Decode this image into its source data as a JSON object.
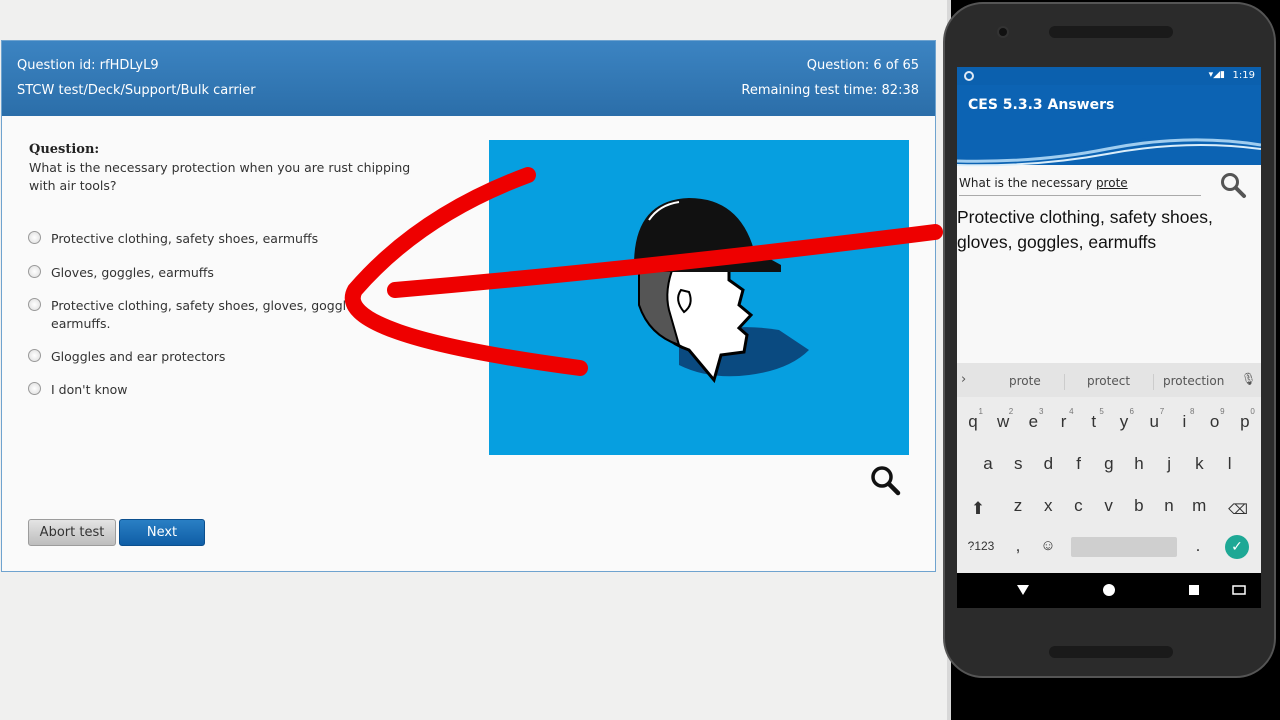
{
  "test": {
    "question_id": "Question id: rfHDLyL9",
    "path": "STCW test/Deck/Support/Bulk carrier",
    "question_count": "Question: 6 of 65",
    "remaining_time": "Remaining test time: 82:38",
    "question_label": "Question:",
    "question_text": "What is the necessary protection when you are rust chipping with air tools?",
    "options": [
      "Protective clothing, safety shoes, earmuffs",
      "Gloves, goggles, earmuffs",
      "Protective clothing, safety shoes, gloves, goggles, earmuffs.",
      "Gloggles and ear protectors",
      "I don't know"
    ],
    "abort_label": "Abort test",
    "next_label": "Next"
  },
  "phone": {
    "status_time": "1:19",
    "app_title": "CES 5.3.3 Answers",
    "search_text_prefix": "What is the necessary ",
    "search_text_underlined": "prote",
    "answer": "Protective clothing, safety shoes, gloves, goggles, earmuffs",
    "suggestions": [
      "prote",
      "protect",
      "protection"
    ],
    "keyboard": {
      "row1": [
        "q",
        "w",
        "e",
        "r",
        "t",
        "y",
        "u",
        "i",
        "o",
        "p"
      ],
      "row1_hints": [
        "1",
        "2",
        "3",
        "4",
        "5",
        "6",
        "7",
        "8",
        "9",
        "0"
      ],
      "row2": [
        "a",
        "s",
        "d",
        "f",
        "g",
        "h",
        "j",
        "k",
        "l"
      ],
      "row3": [
        "z",
        "x",
        "c",
        "v",
        "b",
        "n",
        "m"
      ],
      "symbols_key": "?123",
      "comma": ",",
      "period": "."
    }
  },
  "colors": {
    "header_blue": "#2b6ea9",
    "picture_blue": "#069fe0",
    "annotation_red": "#ee0000",
    "app_blue": "#0c63b3"
  }
}
